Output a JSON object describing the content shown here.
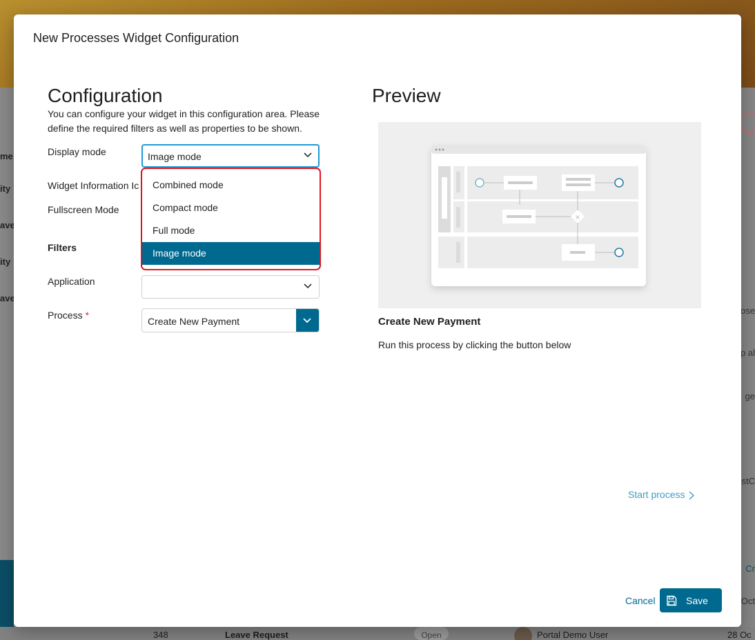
{
  "background": {
    "side_labels": [
      "me",
      "ity",
      "ave",
      "ity",
      "ave"
    ],
    "right_labels": [
      "ose",
      "p al",
      "ge",
      "stC",
      "Cr",
      "Oct"
    ],
    "row": {
      "id": "348",
      "name": "Leave Request",
      "status": "Open",
      "user": "Portal Demo User",
      "date": "28 Oc"
    }
  },
  "modal": {
    "title": "New Processes Widget Configuration",
    "config": {
      "heading": "Configuration",
      "description": "You can configure your widget in this configuration area. Please define the required filters as well as properties to be shown.",
      "display_mode_label": "Display mode",
      "display_mode_value": "Image mode",
      "widget_info_label": "Widget Information Ic",
      "fullscreen_label": "Fullscreen Mode",
      "filters_label": "Filters",
      "application_label": "Application",
      "application_value": "",
      "process_label": "Process",
      "process_required": "*",
      "process_value": "Create New Payment",
      "dropdown_options": [
        "Combined mode",
        "Compact mode",
        "Full mode",
        "Image mode"
      ],
      "dropdown_selected": "Image mode"
    },
    "preview": {
      "heading": "Preview",
      "process_title": "Create New Payment",
      "description": "Run this process by clicking the button below",
      "start_link": "Start process"
    },
    "footer": {
      "cancel_label": "Cancel",
      "save_label": "Save"
    }
  },
  "colors": {
    "primary": "#00698f",
    "focus_border": "#1f9bd6",
    "highlight_border": "#e0141c",
    "link": "#3d9cc4"
  }
}
